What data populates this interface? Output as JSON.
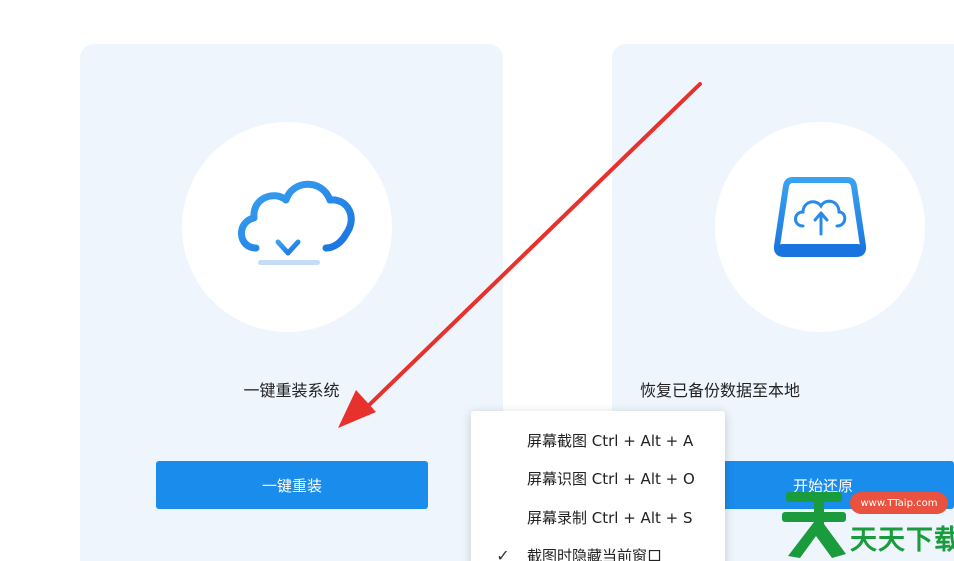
{
  "left_card": {
    "icon": "cloud-download-icon",
    "title": "一键重装系统",
    "button_label": "一键重装"
  },
  "right_card": {
    "icon": "drive-upload-icon",
    "title": "恢复已备份数据至本地",
    "button_label": "开始还原"
  },
  "context_menu": {
    "items": [
      {
        "label": "屏幕截图 Ctrl + Alt + A",
        "checked": false
      },
      {
        "label": "屏幕识图 Ctrl + Alt + O",
        "checked": false
      },
      {
        "label": "屏幕录制 Ctrl + Alt + S",
        "checked": false
      },
      {
        "label": "截图时隐藏当前窗口",
        "checked": true
      }
    ]
  },
  "watermark": {
    "site": "www.TTaip.com",
    "text": "天天下载"
  },
  "colors": {
    "accent": "#1a8cec",
    "card_bg": "#eef5fc",
    "arrow": "#e8312c",
    "watermark_green": "#1b9c3c"
  }
}
